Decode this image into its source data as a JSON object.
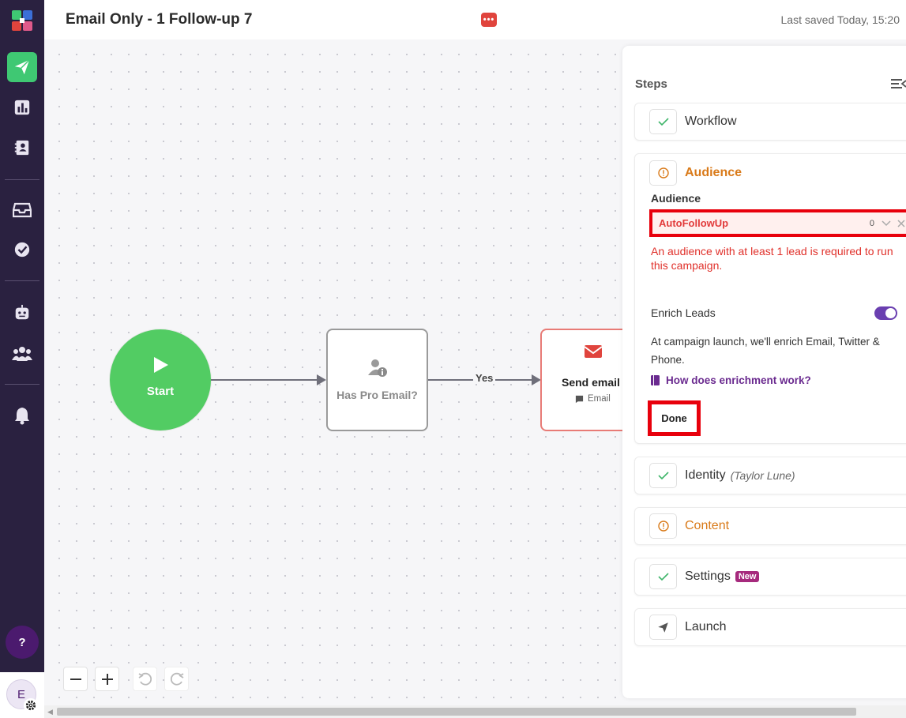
{
  "header": {
    "title": "Email Only - 1 Follow-up 7",
    "more_icon_text": "•••",
    "last_saved": "Last saved Today, 15:20"
  },
  "sidebar": {
    "items": [
      {
        "name": "campaigns",
        "icon": "paper-plane-icon",
        "active": true
      },
      {
        "name": "analytics",
        "icon": "bar-chart-icon"
      },
      {
        "name": "contacts",
        "icon": "contact-book-icon"
      },
      {
        "name": "inbox",
        "icon": "inbox-tray-icon"
      },
      {
        "name": "tasks",
        "icon": "check-circle-icon"
      },
      {
        "name": "bot",
        "icon": "robot-icon"
      },
      {
        "name": "team",
        "icon": "users-icon"
      },
      {
        "name": "notifications",
        "icon": "bell-icon"
      }
    ],
    "help_label": "?",
    "avatar_initial": "E",
    "active_color": "#3fc873"
  },
  "canvas": {
    "start_label": "Start",
    "condition_label": "Has Pro Email?",
    "edge_yes_label": "Yes",
    "email_node": {
      "label": "Send email",
      "sublabel": "Email"
    }
  },
  "steps": {
    "title": "Steps",
    "workflow": {
      "label": "Workflow",
      "status": "done"
    },
    "audience": {
      "label": "Audience",
      "status": "warning",
      "field_label": "Audience",
      "selected_value": "AutoFollowUp",
      "lead_count": "0",
      "error": "An audience with at least 1 lead is required to run this campaign.",
      "enrich_label": "Enrich Leads",
      "enrich_enabled": true,
      "enrich_description": "At campaign launch, we'll enrich Email, Twitter & Phone.",
      "enrich_link": "How does enrichment work?",
      "done_label": "Done"
    },
    "identity": {
      "label": "Identity",
      "detail": "(Taylor Lune)",
      "status": "done"
    },
    "content": {
      "label": "Content",
      "status": "warning"
    },
    "settings": {
      "label": "Settings",
      "badge": "New",
      "status": "done"
    },
    "launch": {
      "label": "Launch"
    }
  },
  "colors": {
    "warning": "#d97a19",
    "error": "#e0302a",
    "highlight": "#e8000c",
    "start_node": "#52cc63",
    "toggle": "#6a3fb0"
  }
}
